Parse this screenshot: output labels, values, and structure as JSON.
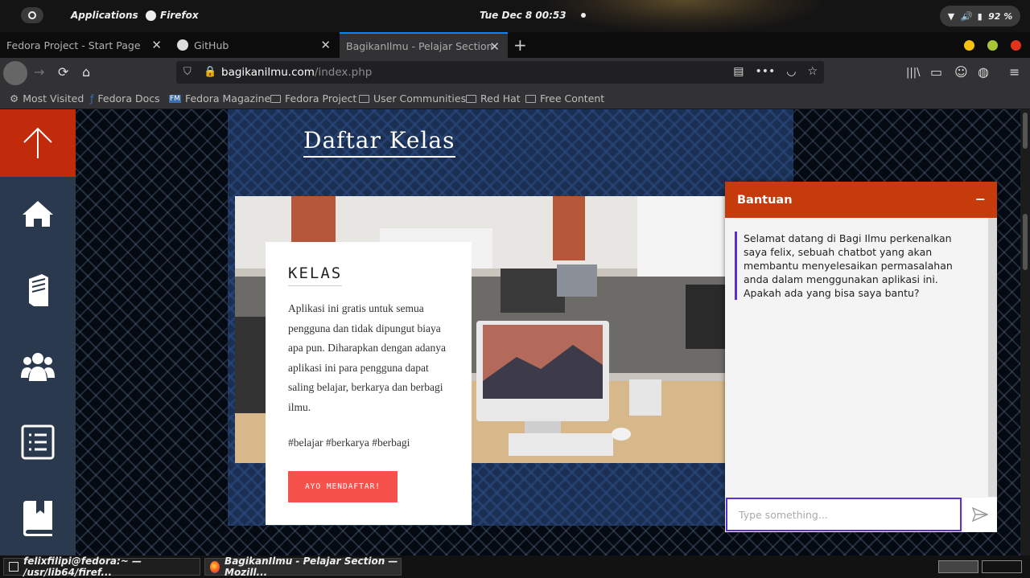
{
  "topbar": {
    "applications": "Applications",
    "firefox": "Firefox",
    "clock": "Tue Dec 8  00:53",
    "battery": "92 %"
  },
  "tabs": [
    {
      "label": "Fedora Project - Start Page"
    },
    {
      "label": "GitHub"
    },
    {
      "label": "BagikanIlmu - Pelajar Section"
    }
  ],
  "url": {
    "host": "bagikanilmu.com",
    "path": "/index.php"
  },
  "bookmarks": [
    "Most Visited",
    "Fedora Docs",
    "Fedora Magazine",
    "Fedora Project",
    "User Communities",
    "Red Hat",
    "Free Content"
  ],
  "page": {
    "heading": "Daftar Kelas",
    "card": {
      "title": "KELAS",
      "body": "Aplikasi ini gratis untuk semua pengguna dan tidak dipungut biaya apa pun. Diharapkan dengan adanya aplikasi ini para pengguna dapat saling belajar, berkarya dan berbagi ilmu.",
      "tags": "#belajar #berkarya #berbagi",
      "button": "AYO MENDAFTAR!"
    }
  },
  "chat": {
    "title": "Bantuan",
    "minimize": "−",
    "message": "Selamat datang di Bagi Ilmu perkenalkan saya felix, sebuah chatbot yang akan membantu menyelesaikan permasalahan anda dalam menggunakan aplikasi ini. Apakah ada yang bisa saya bantu?",
    "placeholder": "Type something..."
  },
  "taskbar": {
    "terminal": "felixfilipi@fedora:~ — /usr/lib64/firef...",
    "browser": "BagikanIlmu - Pelajar Section — Mozill..."
  },
  "colors": {
    "accent": "#c53b0b",
    "sidebar": "#2a394e",
    "button": "#f5524c",
    "focus": "#5b2fd6"
  }
}
